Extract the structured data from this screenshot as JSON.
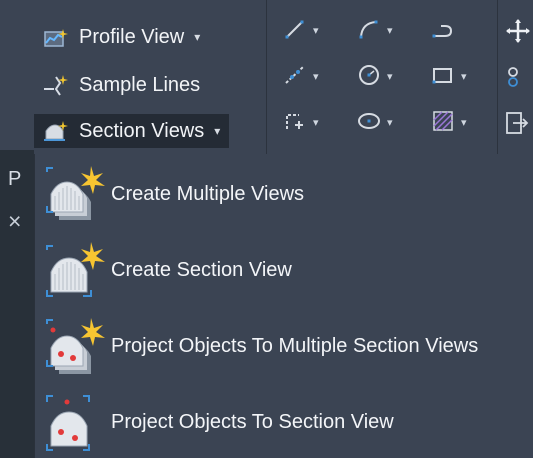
{
  "ribbon": {
    "buttons": [
      {
        "label": "Profile View",
        "has_caret": true,
        "icon": "profile-view-icon"
      },
      {
        "label": "Sample Lines",
        "has_caret": false,
        "icon": "sample-lines-icon"
      },
      {
        "label": "Section Views",
        "has_caret": true,
        "icon": "section-views-icon"
      }
    ],
    "caret_glyph": "▾",
    "tools": [
      {
        "icon": "line-icon"
      },
      {
        "icon": "arc-icon"
      },
      {
        "icon": "polyline-icon"
      },
      {
        "icon": "polyline-edit-icon"
      },
      {
        "icon": "circle-icon"
      },
      {
        "icon": "rectangle-icon"
      },
      {
        "icon": "edit-polyline-icon"
      },
      {
        "icon": "ellipse-icon"
      },
      {
        "icon": "hatch-icon"
      }
    ],
    "far_right_tools": [
      {
        "icon": "move-icon"
      },
      {
        "icon": "copy-icon"
      },
      {
        "icon": "stretch-icon"
      }
    ]
  },
  "side_panel": {
    "letter": "P",
    "close_glyph": "×"
  },
  "menu": {
    "items": [
      {
        "label": "Create Multiple Views",
        "icon": "create-multiple-views-icon"
      },
      {
        "label": "Create Section View",
        "icon": "create-section-view-icon"
      },
      {
        "label": "Project Objects To Multiple Section Views",
        "icon": "project-objects-multiple-icon"
      },
      {
        "label": "Project Objects To Section View",
        "icon": "project-objects-section-icon"
      }
    ]
  },
  "colors": {
    "background": "#3b4453",
    "active_button": "#242b35",
    "text": "#f3f5f8",
    "accent_blue": "#3e8fd6",
    "accent_yellow": "#f2c62f",
    "accent_red": "#e23a3a"
  }
}
